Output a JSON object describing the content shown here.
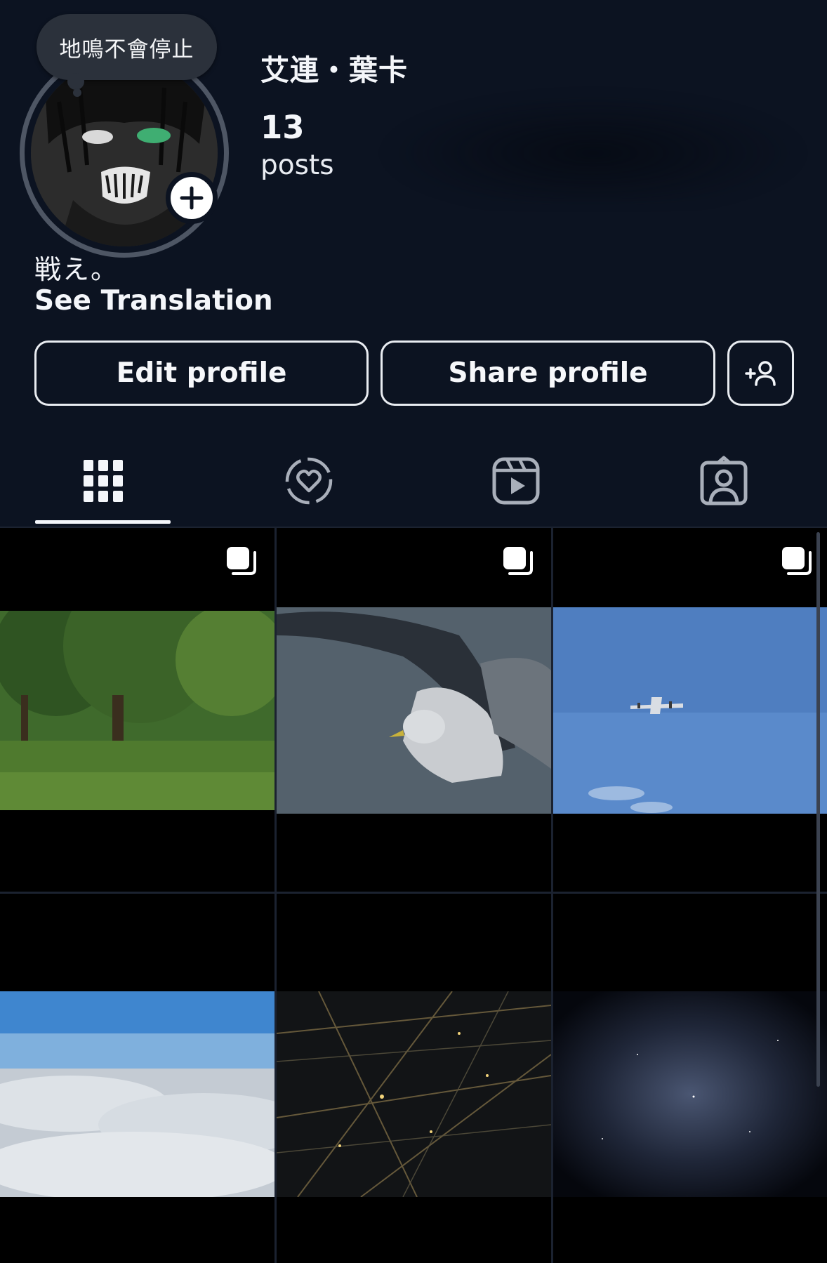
{
  "profile": {
    "note": "地鳴不會停止",
    "username": "艾連・葉卡",
    "posts_count": "13",
    "posts_label": "posts",
    "bio": "戦え。",
    "see_translation": "See Translation"
  },
  "actions": {
    "edit_profile": "Edit profile",
    "share_profile": "Share profile"
  },
  "tabs": [
    {
      "name": "posts-grid",
      "icon": "grid-icon",
      "selected": true
    },
    {
      "name": "collabs",
      "icon": "heart-circle-icon",
      "selected": false
    },
    {
      "name": "reels",
      "icon": "reels-icon",
      "selected": false
    },
    {
      "name": "tagged",
      "icon": "tagged-person-icon",
      "selected": false
    }
  ],
  "posts": [
    {
      "subject": "trees in park",
      "multi": true
    },
    {
      "subject": "seagull over water",
      "multi": true
    },
    {
      "subject": "airplane in blue sky",
      "multi": true
    },
    {
      "subject": "sea of clouds",
      "multi": false
    },
    {
      "subject": "city lights at night",
      "multi": false
    },
    {
      "subject": "night sky",
      "multi": false
    }
  ],
  "colors": {
    "background": "#0c1321",
    "text": "#f4f6fa",
    "note_bubble": "#2b313b",
    "avatar_ring": "#4e5664"
  }
}
